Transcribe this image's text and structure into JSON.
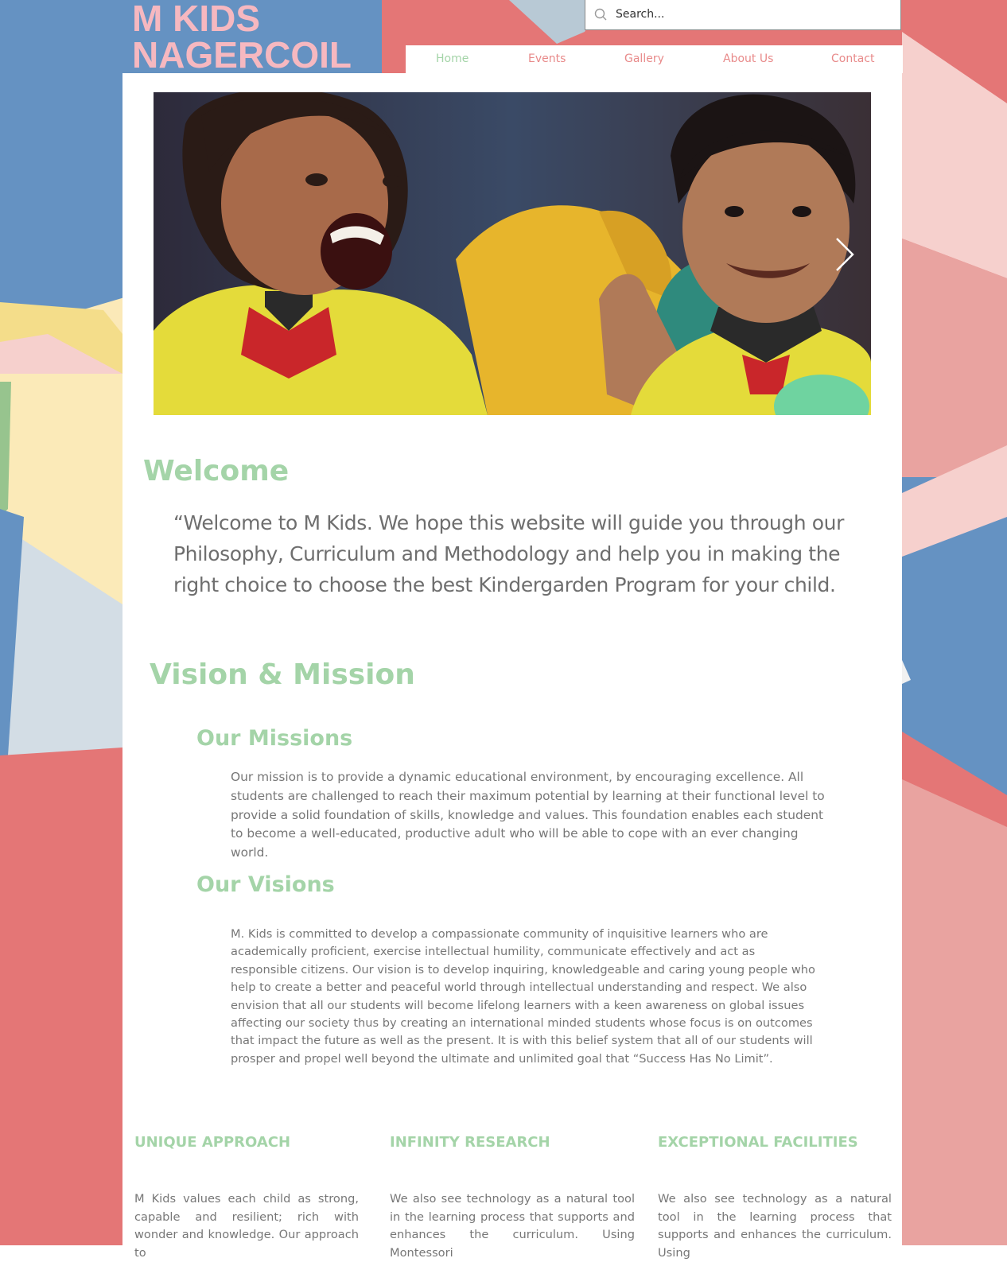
{
  "site": {
    "logo_line1": "M KIDS",
    "logo_line2": "NAGERCOIL"
  },
  "search": {
    "placeholder": "Search..."
  },
  "nav": {
    "items": [
      {
        "label": "Home",
        "active": true
      },
      {
        "label": "Events"
      },
      {
        "label": "Gallery"
      },
      {
        "label": "About Us"
      },
      {
        "label": "Contact"
      }
    ]
  },
  "welcome": {
    "title": "Welcome",
    "quote": "“Welcome to M Kids. We hope this website will guide you through our Philosophy, Curriculum and Methodology and help you in making the right choice to choose the best Kindergarden Program for your child."
  },
  "vision_mission": {
    "title": "Vision & Mission",
    "missions_title": "Our Missions",
    "missions_text": "Our mission is to provide a dynamic educational environment, by encouraging excellence. All students are challenged to reach their maximum potential by learning at their functional level to provide a solid foundation of skills, knowledge and values. This foundation enables each student to become a well-educated, productive adult who will be able to cope with an ever changing world.",
    "visions_title": "Our Visions",
    "visions_text": "M. Kids is committed to develop a compassionate community of inquisitive learners who are academically proficient, exercise intellectual humility, communicate effectively and act as responsible citizens. Our vision is to develop inquiring, knowledgeable and caring young people who help to create a better and peaceful world through intellectual understanding and respect. We also envision that all our students will become lifelong learners with a keen awareness on global issues affecting our society thus by creating an international minded students whose focus is on outcomes that impact the future as well as the present. It is with this belief system that all of our students will prosper and propel well beyond the ultimate and unlimited goal that “Success Has No Limit”."
  },
  "features": [
    {
      "title": "UNIQUE APPROACH",
      "text": "M Kids values each child as strong, capable and resilient; rich with wonder and knowledge. Our approach to"
    },
    {
      "title": "INFINITY RESEARCH",
      "text": "We also see technology as a natural tool in the learning process that supports and enhances the curriculum. Using Montessori"
    },
    {
      "title": "EXCEPTIONAL FACILITIES",
      "text": "We also see technology as a natural tool in the learning process that supports and enhances the curriculum. Using"
    }
  ],
  "colors": {
    "accent_green": "#a4d4a8",
    "nav_pink": "#e88a8a",
    "logo_pink": "#f6b8c0",
    "body_gray": "#777777"
  },
  "icons": {
    "search": "search-icon",
    "slider_next": "chevron-right-icon"
  }
}
